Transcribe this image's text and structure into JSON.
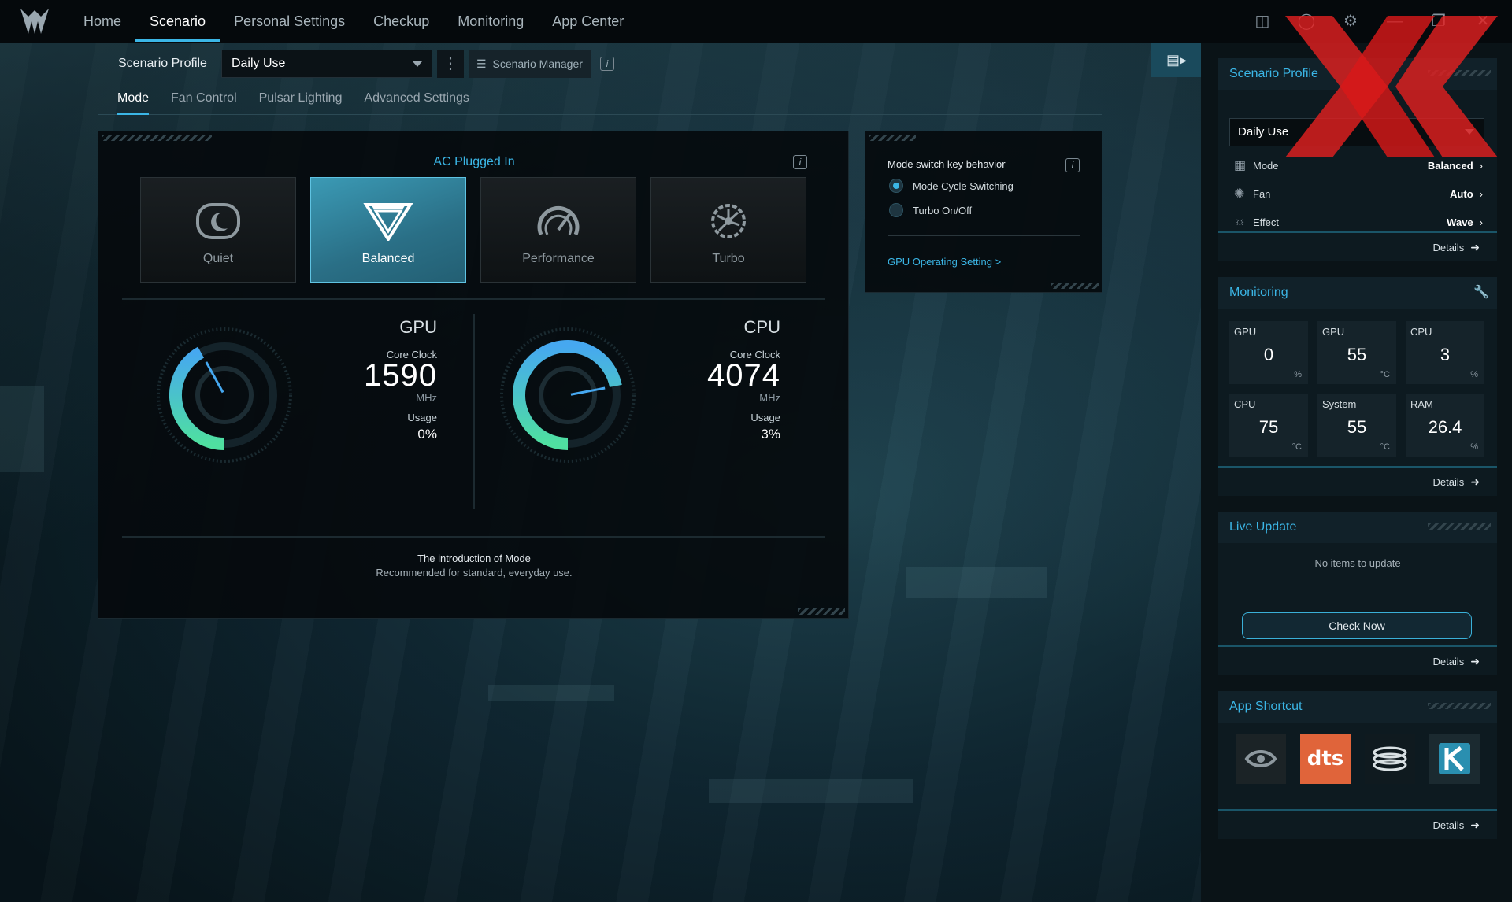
{
  "nav": {
    "items": [
      "Home",
      "Scenario",
      "Personal Settings",
      "Checkup",
      "Monitoring",
      "App Center"
    ],
    "active": "Scenario"
  },
  "profile_bar": {
    "label": "Scenario Profile",
    "selected": "Daily Use",
    "manager_label": "Scenario Manager"
  },
  "subtabs": {
    "items": [
      "Mode",
      "Fan Control",
      "Pulsar Lighting",
      "Advanced Settings"
    ],
    "active": "Mode"
  },
  "mode_panel": {
    "power_state": "AC Plugged In",
    "modes": [
      {
        "label": "Quiet",
        "icon": "quiet-mode-icon"
      },
      {
        "label": "Balanced",
        "icon": "balanced-mode-icon"
      },
      {
        "label": "Performance",
        "icon": "performance-mode-icon"
      },
      {
        "label": "Turbo",
        "icon": "turbo-mode-icon"
      }
    ],
    "selected_mode": "Balanced",
    "gpu": {
      "title": "GPU",
      "clock_label": "Core Clock",
      "clock": "1590",
      "clock_unit": "MHz",
      "usage_label": "Usage",
      "usage": "0%",
      "gauge_fraction": 0.42
    },
    "cpu": {
      "title": "CPU",
      "clock_label": "Core Clock",
      "clock": "4074",
      "clock_unit": "MHz",
      "usage_label": "Usage",
      "usage": "3%",
      "gauge_fraction": 0.72
    },
    "intro_title": "The introduction of Mode",
    "intro_desc": "Recommended for standard, everyday use."
  },
  "switch_panel": {
    "title": "Mode switch key behavior",
    "options": [
      "Mode Cycle Switching",
      "Turbo On/Off"
    ],
    "selected": "Mode Cycle Switching",
    "link": "GPU Operating Setting >"
  },
  "sidebar": {
    "details_label": "Details",
    "scenario_profile": {
      "title": "Scenario Profile",
      "selected": "Daily Use",
      "rows": [
        {
          "label": "Mode",
          "value": "Balanced",
          "icon": "mode-grid-icon"
        },
        {
          "label": "Fan",
          "value": "Auto",
          "icon": "fan-icon"
        },
        {
          "label": "Effect",
          "value": "Wave",
          "icon": "effect-sun-icon"
        }
      ]
    },
    "monitoring": {
      "title": "Monitoring",
      "cells": [
        {
          "label": "GPU",
          "value": "0",
          "unit": "%"
        },
        {
          "label": "GPU",
          "value": "55",
          "unit": "°C"
        },
        {
          "label": "CPU",
          "value": "3",
          "unit": "%"
        },
        {
          "label": "CPU",
          "value": "75",
          "unit": "°C"
        },
        {
          "label": "System",
          "value": "55",
          "unit": "°C"
        },
        {
          "label": "RAM",
          "value": "26.4",
          "unit": "%"
        }
      ]
    },
    "live_update": {
      "title": "Live Update",
      "status": "No items to update",
      "button": "Check Now"
    },
    "app_shortcut": {
      "title": "App Shortcut",
      "apps": [
        "nvidia-icon",
        "dts-icon",
        "ring-icon",
        "k-icon"
      ],
      "dts_text": "dts"
    }
  },
  "colors": {
    "accent": "#3bb6e6",
    "selected_mode": "#3b9ab5",
    "gauge_start": "#4fe0a0",
    "gauge_end": "#46a8f0",
    "watermark": "#e02020"
  }
}
